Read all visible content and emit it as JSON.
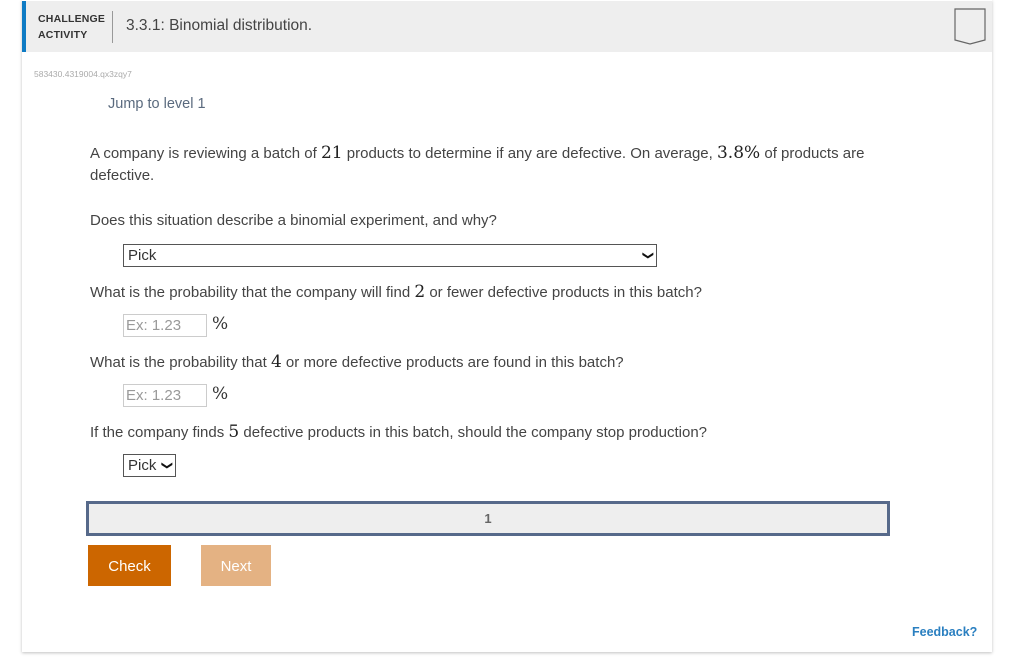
{
  "header": {
    "label_line1": "CHALLENGE",
    "label_line2": "ACTIVITY",
    "title": "3.3.1: Binomial distribution.",
    "accent_color": "#0e7bc4"
  },
  "activity_id": "583430.4319004.qx3zqy7",
  "jump_link": "Jump to level 1",
  "prompt": {
    "part1": "A company is reviewing a batch of ",
    "n": "21",
    "part2": " products to determine if any are defective. On average, ",
    "p": "3.8%",
    "part3": " of products are defective."
  },
  "questions": [
    {
      "text": "Does this situation describe a binomial experiment, and why?",
      "select_value": "Pick"
    },
    {
      "pre": "What is the probability that the company will find ",
      "num": "2",
      "post": " or fewer defective products in this batch?",
      "placeholder": "Ex: 1.23",
      "unit": "%"
    },
    {
      "pre": "What is the probability that ",
      "num": "4",
      "post": " or more defective products are found in this batch?",
      "placeholder": "Ex: 1.23",
      "unit": "%"
    },
    {
      "pre": "If the company finds ",
      "num": "5",
      "post": " defective products in this batch, should the company stop production?",
      "select_value": "Pick"
    }
  ],
  "level_bar": {
    "current_level": "1"
  },
  "buttons": {
    "check": "Check",
    "next": "Next"
  },
  "feedback_link": "Feedback?",
  "icons": {
    "bookmark": "bookmark-icon",
    "dropdown": "chevron-down-icon"
  }
}
